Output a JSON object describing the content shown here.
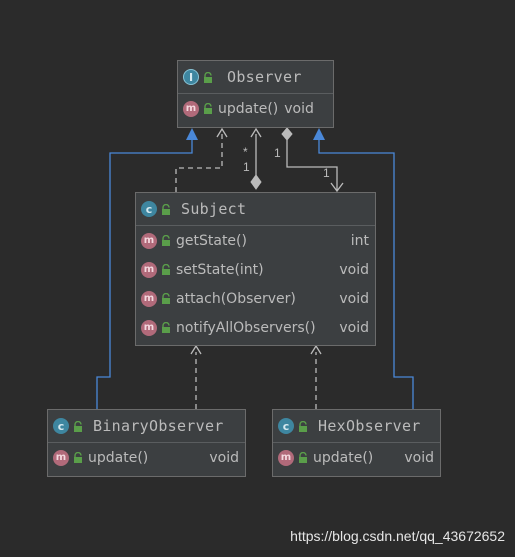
{
  "diagram": {
    "observer": {
      "name": "Observer",
      "badge": "I",
      "methods": [
        {
          "name": "update()",
          "return": "void"
        }
      ]
    },
    "subject": {
      "name": "Subject",
      "badge": "c",
      "methods": [
        {
          "name": "getState()",
          "return": "int"
        },
        {
          "name": "setState(int)",
          "return": "void"
        },
        {
          "name": "attach(Observer)",
          "return": "void"
        },
        {
          "name": "notifyAllObservers()",
          "return": "void"
        }
      ]
    },
    "binary_observer": {
      "name": "BinaryObserver",
      "badge": "c",
      "methods": [
        {
          "name": "update()",
          "return": "void"
        }
      ]
    },
    "hex_observer": {
      "name": "HexObserver",
      "badge": "c",
      "methods": [
        {
          "name": "update()",
          "return": "void"
        }
      ]
    },
    "multiplicities": {
      "aggregation_star": "*",
      "aggregation_one": "1",
      "association_source": "1",
      "association_target": "1"
    },
    "method_badge": "m"
  },
  "watermark": "https://blog.csdn.net/qq_43672652",
  "colors": {
    "background": "#2b2b2b",
    "box": "#3c3f41",
    "inheritance": "#4a88d8",
    "dependency": "#bbbbbb",
    "class_badge": "#3e86a0",
    "method_badge": "#b16a7a",
    "lock": "#5a9e4a"
  }
}
